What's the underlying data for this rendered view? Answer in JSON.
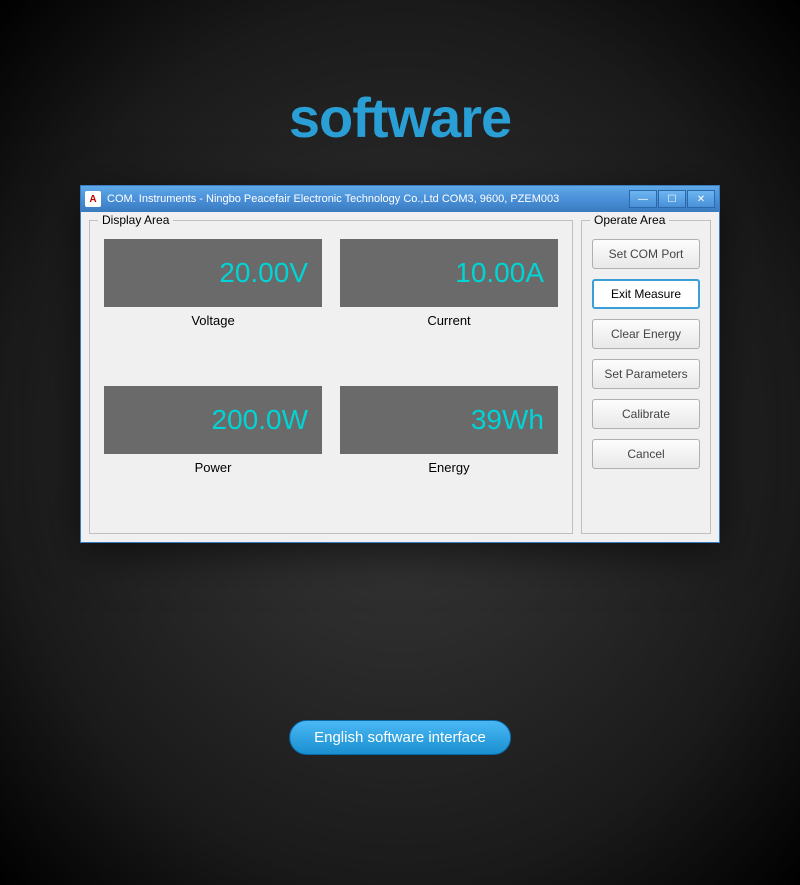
{
  "page": {
    "heading": "software",
    "caption": "English software interface"
  },
  "window": {
    "title": "COM. Instruments - Ningbo Peacefair Electronic Technology Co.,Ltd  COM3, 9600, PZEM003",
    "icon_letter": "A"
  },
  "display": {
    "group_label": "Display Area",
    "readouts": {
      "voltage": {
        "value": "20.00V",
        "label": "Voltage"
      },
      "current": {
        "value": "10.00A",
        "label": "Current"
      },
      "power": {
        "value": "200.0W",
        "label": "Power"
      },
      "energy": {
        "value": "39Wh",
        "label": "Energy"
      }
    }
  },
  "operate": {
    "group_label": "Operate Area",
    "buttons": {
      "set_com": "Set COM Port",
      "exit_measure": "Exit Measure",
      "clear_energy": "Clear Energy",
      "set_parameters": "Set Parameters",
      "calibrate": "Calibrate",
      "cancel": "Cancel"
    }
  }
}
